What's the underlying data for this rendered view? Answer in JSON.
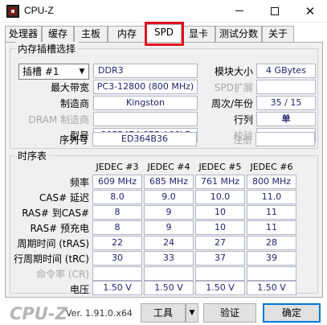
{
  "window": {
    "title": "CPU-Z",
    "minimize_icon": "minimize-icon",
    "maximize_icon": "maximize-icon",
    "close_icon": "close-icon",
    "close_glyph": "✕"
  },
  "tabs": [
    {
      "label": "处理器",
      "active": false
    },
    {
      "label": "缓存",
      "active": false
    },
    {
      "label": "主板",
      "active": false
    },
    {
      "label": "内存",
      "active": false
    },
    {
      "label": "SPD",
      "active": true
    },
    {
      "label": "显卡",
      "active": false
    },
    {
      "label": "测试分数",
      "active": false
    },
    {
      "label": "关于",
      "active": false
    }
  ],
  "highlight_color": "#e01020",
  "slot": {
    "group_title": "内存插槽选择",
    "selected": "插槽 #1",
    "type": "DDR3",
    "module_size_label": "模块大小",
    "module_size": "4 GBytes",
    "max_bandwidth_label": "最大带宽",
    "max_bandwidth": "PC3-12800 (800 MHz)",
    "spd_ext_label": "SPD扩展",
    "spd_ext": "",
    "manufacturer_label": "制造商",
    "manufacturer": "Kingston",
    "week_year_label": "周次/年份",
    "week_year": "35 / 15",
    "dram_mfr_label": "DRAM 制造商",
    "dram_mfr": "",
    "ranks_label": "行列",
    "ranks": "单",
    "part_number_label": "型号",
    "part_number": "99P5474-055.A00LF",
    "correction_label": "校验",
    "correction": "",
    "serial_label": "序列号",
    "serial": "ED364B36",
    "registered_label": "注册",
    "registered": ""
  },
  "timings": {
    "group_title": "时序表",
    "columns": [
      "JEDEC #3",
      "JEDEC #4",
      "JEDEC #5",
      "JEDEC #6"
    ],
    "rows": [
      {
        "label": "频率",
        "values": [
          "609 MHz",
          "685 MHz",
          "761 MHz",
          "800 MHz"
        ],
        "disabled": false
      },
      {
        "label": "CAS# 延迟",
        "values": [
          "8.0",
          "9.0",
          "10.0",
          "11.0"
        ],
        "disabled": false
      },
      {
        "label": "RAS# 到CAS#",
        "values": [
          "8",
          "9",
          "10",
          "11"
        ],
        "disabled": false
      },
      {
        "label": "RAS# 预充电",
        "values": [
          "8",
          "9",
          "10",
          "11"
        ],
        "disabled": false
      },
      {
        "label": "周期时间 (tRAS)",
        "values": [
          "22",
          "24",
          "27",
          "28"
        ],
        "disabled": false
      },
      {
        "label": "行周期时间 (tRC)",
        "values": [
          "30",
          "33",
          "37",
          "39"
        ],
        "disabled": false
      },
      {
        "label": "命令率 (CR)",
        "values": [
          "",
          "",
          "",
          ""
        ],
        "disabled": true
      },
      {
        "label": "电压",
        "values": [
          "1.50 V",
          "1.50 V",
          "1.50 V",
          "1.50 V"
        ],
        "disabled": false
      }
    ]
  },
  "footer": {
    "logo": "CPU-Z",
    "version": "Ver. 1.91.0.x64",
    "tools_label": "工具",
    "validate_label": "验证",
    "ok_label": "确定"
  }
}
